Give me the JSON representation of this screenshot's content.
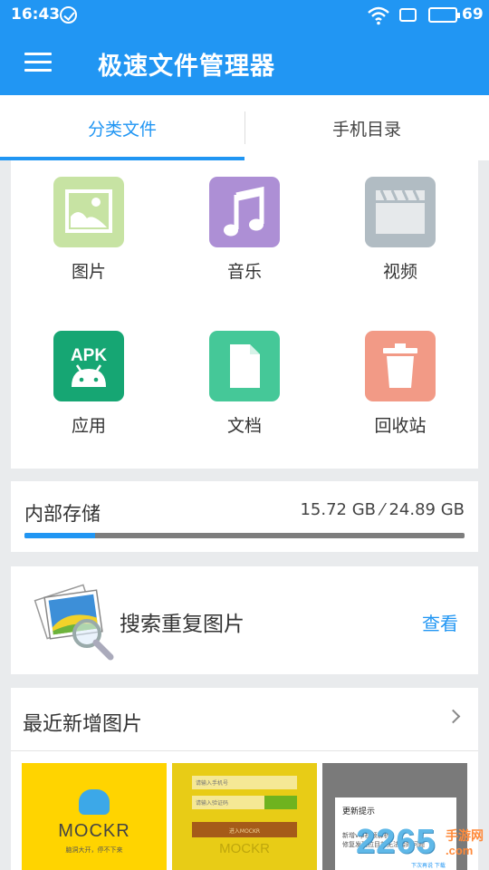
{
  "status_bar": {
    "time": "16:43",
    "battery_pct": "69",
    "battery_level": 0.69
  },
  "app_bar": {
    "title": "极速文件管理器"
  },
  "tabs": [
    {
      "label": "分类文件",
      "active": true
    },
    {
      "label": "手机目录",
      "active": false
    }
  ],
  "categories": [
    {
      "label": "图片",
      "icon": "image-icon",
      "color": "#c7e3a3"
    },
    {
      "label": "音乐",
      "icon": "music-note-icon",
      "color": "#ad8fd5"
    },
    {
      "label": "视频",
      "icon": "clapperboard-icon",
      "color": "#b1bcc3"
    },
    {
      "label": "应用",
      "icon": "apk-android-icon",
      "color": "#16a673",
      "icon_text": "APK"
    },
    {
      "label": "文档",
      "icon": "document-icon",
      "color": "#45c898"
    },
    {
      "label": "回收站",
      "icon": "trash-icon",
      "color": "#f29a86"
    }
  ],
  "storage": {
    "label": "内部存储",
    "value": "15.72 GB ⁄ 24.89 GB",
    "used_fraction": 0.16
  },
  "duplicate": {
    "label": "搜索重复图片",
    "action": "查看",
    "icon": "photo-stack-magnifier-icon"
  },
  "recent": {
    "label": "最近新增图片",
    "thumbnails": [
      {
        "brand": "MOCKR",
        "subtitle": "脑洞大开，停不下来"
      },
      {
        "field1": "请输入手机号",
        "field2": "请输入验证码",
        "button": "进入MOCKR",
        "ghost": "MOCKR"
      },
      {
        "dialog_title": "更新提示",
        "dialog_line1": "新增vip视频解析",
        "dialog_line2": "修复发现拉目前无法接的问题",
        "dialog_buttons": "下次再说   下载"
      }
    ]
  },
  "watermark": {
    "text": "2265",
    "tag": "手游网",
    "url": ".com"
  }
}
